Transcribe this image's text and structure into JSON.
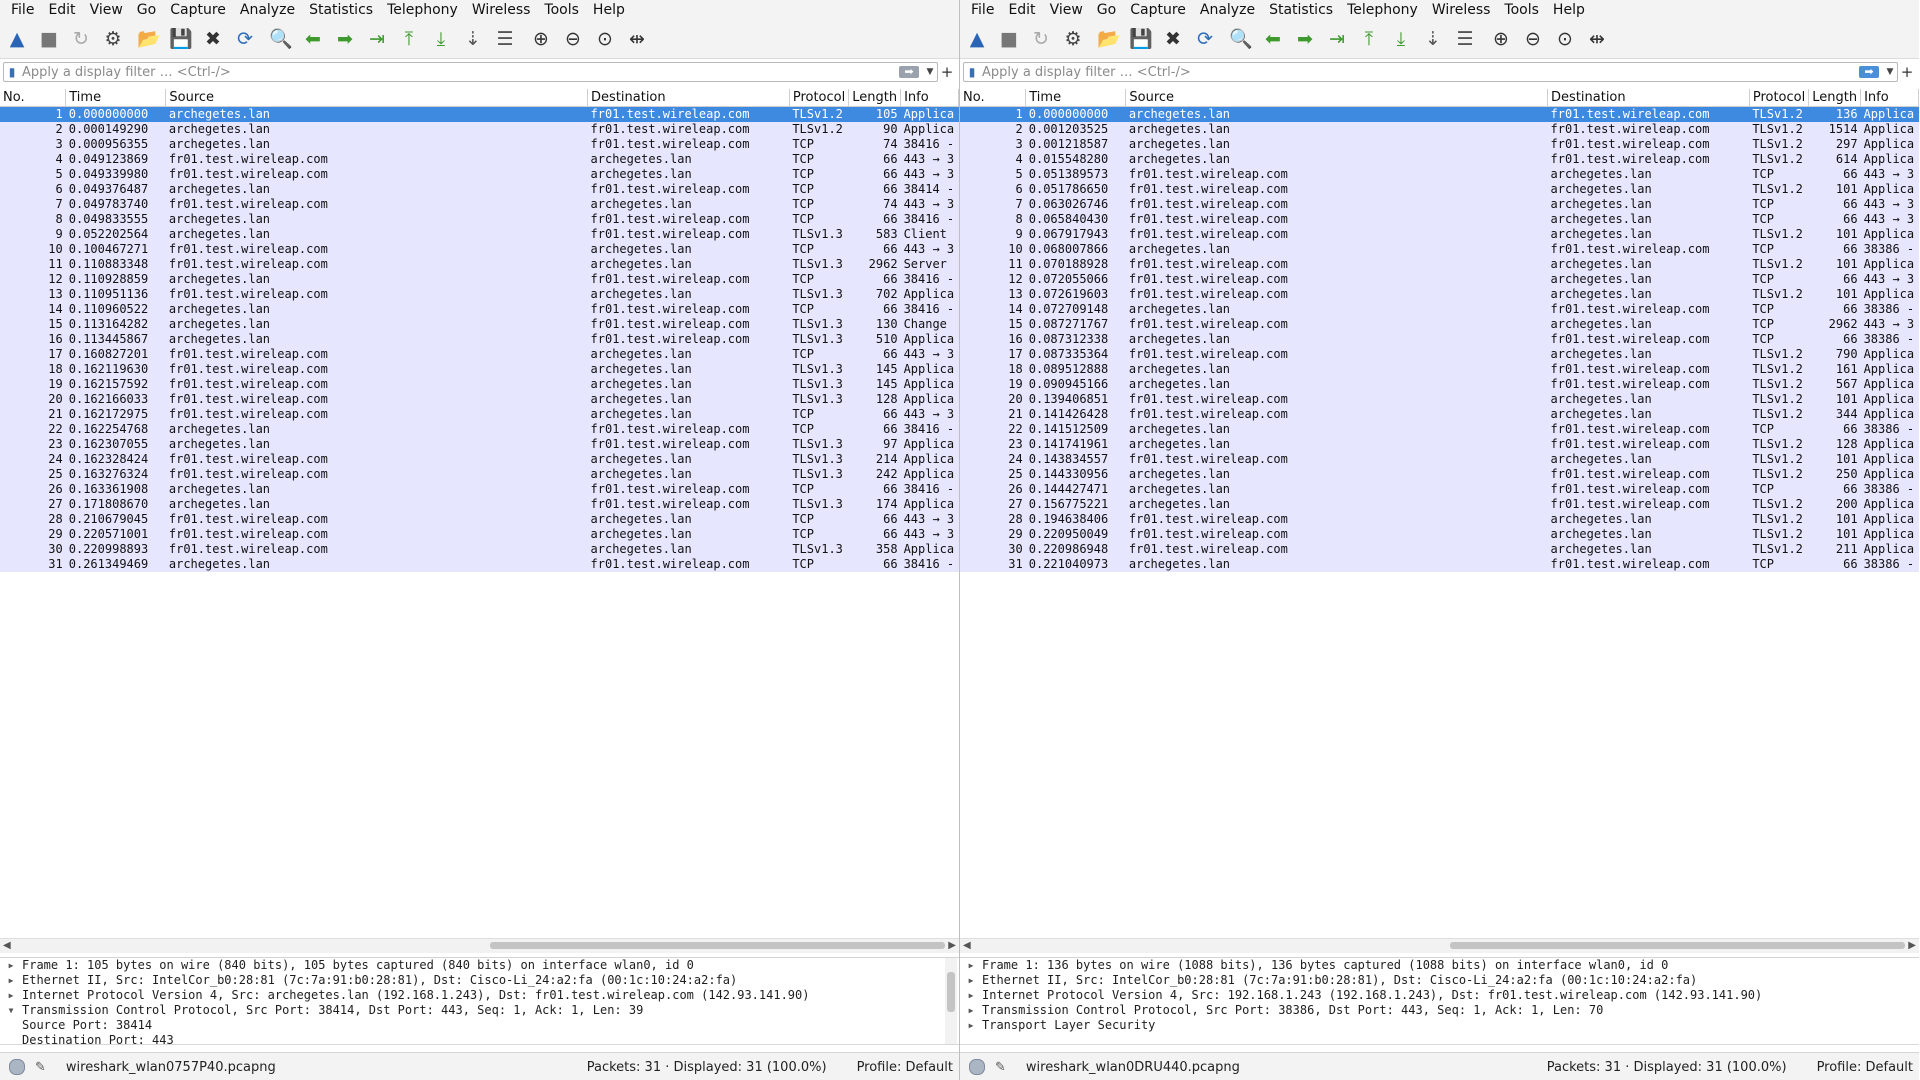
{
  "menu": [
    "File",
    "Edit",
    "View",
    "Go",
    "Capture",
    "Analyze",
    "Statistics",
    "Telephony",
    "Wireless",
    "Tools",
    "Help"
  ],
  "toolbar_icons": [
    "start-capture-icon",
    "stop-capture-icon",
    "restart-capture-icon",
    "capture-options-icon",
    "open-file-icon",
    "save-file-icon",
    "close-file-icon",
    "reload-file-icon",
    "find-packet-icon",
    "go-back-icon",
    "go-forward-icon",
    "go-to-packet-icon",
    "first-packet-icon",
    "last-packet-icon",
    "auto-scroll-icon",
    "colorize-icon",
    "zoom-in-icon",
    "zoom-out-icon",
    "normal-size-icon",
    "resize-columns-icon"
  ],
  "filter_placeholder": "Apply a display filter … <Ctrl-/>",
  "columns": [
    "No.",
    "Time",
    "Source",
    "Destination",
    "Protocol",
    "Length",
    "Info"
  ],
  "left": {
    "packets": [
      [
        "1",
        "0.000000000",
        "archegetes.lan",
        "fr01.test.wireleap.com",
        "TLSv1.2",
        "105",
        "Applica"
      ],
      [
        "2",
        "0.000149290",
        "archegetes.lan",
        "fr01.test.wireleap.com",
        "TLSv1.2",
        "90",
        "Applica"
      ],
      [
        "3",
        "0.000956355",
        "archegetes.lan",
        "fr01.test.wireleap.com",
        "TCP",
        "74",
        "38416 -"
      ],
      [
        "4",
        "0.049123869",
        "fr01.test.wireleap.com",
        "archegetes.lan",
        "TCP",
        "66",
        "443 → 3"
      ],
      [
        "5",
        "0.049339980",
        "fr01.test.wireleap.com",
        "archegetes.lan",
        "TCP",
        "66",
        "443 → 3"
      ],
      [
        "6",
        "0.049376487",
        "archegetes.lan",
        "fr01.test.wireleap.com",
        "TCP",
        "66",
        "38414 -"
      ],
      [
        "7",
        "0.049783740",
        "fr01.test.wireleap.com",
        "archegetes.lan",
        "TCP",
        "74",
        "443 → 3"
      ],
      [
        "8",
        "0.049833555",
        "archegetes.lan",
        "fr01.test.wireleap.com",
        "TCP",
        "66",
        "38416 -"
      ],
      [
        "9",
        "0.052202564",
        "archegetes.lan",
        "fr01.test.wireleap.com",
        "TLSv1.3",
        "583",
        "Client"
      ],
      [
        "10",
        "0.100467271",
        "fr01.test.wireleap.com",
        "archegetes.lan",
        "TCP",
        "66",
        "443 → 3"
      ],
      [
        "11",
        "0.110883348",
        "fr01.test.wireleap.com",
        "archegetes.lan",
        "TLSv1.3",
        "2962",
        "Server"
      ],
      [
        "12",
        "0.110928859",
        "archegetes.lan",
        "fr01.test.wireleap.com",
        "TCP",
        "66",
        "38416 -"
      ],
      [
        "13",
        "0.110951136",
        "fr01.test.wireleap.com",
        "archegetes.lan",
        "TLSv1.3",
        "702",
        "Applica"
      ],
      [
        "14",
        "0.110960522",
        "archegetes.lan",
        "fr01.test.wireleap.com",
        "TCP",
        "66",
        "38416 -"
      ],
      [
        "15",
        "0.113164282",
        "archegetes.lan",
        "fr01.test.wireleap.com",
        "TLSv1.3",
        "130",
        "Change"
      ],
      [
        "16",
        "0.113445867",
        "archegetes.lan",
        "fr01.test.wireleap.com",
        "TLSv1.3",
        "510",
        "Applica"
      ],
      [
        "17",
        "0.160827201",
        "fr01.test.wireleap.com",
        "archegetes.lan",
        "TCP",
        "66",
        "443 → 3"
      ],
      [
        "18",
        "0.162119630",
        "fr01.test.wireleap.com",
        "archegetes.lan",
        "TLSv1.3",
        "145",
        "Applica"
      ],
      [
        "19",
        "0.162157592",
        "fr01.test.wireleap.com",
        "archegetes.lan",
        "TLSv1.3",
        "145",
        "Applica"
      ],
      [
        "20",
        "0.162166033",
        "fr01.test.wireleap.com",
        "archegetes.lan",
        "TLSv1.3",
        "128",
        "Applica"
      ],
      [
        "21",
        "0.162172975",
        "fr01.test.wireleap.com",
        "archegetes.lan",
        "TCP",
        "66",
        "443 → 3"
      ],
      [
        "22",
        "0.162254768",
        "archegetes.lan",
        "fr01.test.wireleap.com",
        "TCP",
        "66",
        "38416 -"
      ],
      [
        "23",
        "0.162307055",
        "archegetes.lan",
        "fr01.test.wireleap.com",
        "TLSv1.3",
        "97",
        "Applica"
      ],
      [
        "24",
        "0.162328424",
        "fr01.test.wireleap.com",
        "archegetes.lan",
        "TLSv1.3",
        "214",
        "Applica"
      ],
      [
        "25",
        "0.163276324",
        "fr01.test.wireleap.com",
        "archegetes.lan",
        "TLSv1.3",
        "242",
        "Applica"
      ],
      [
        "26",
        "0.163361908",
        "archegetes.lan",
        "fr01.test.wireleap.com",
        "TCP",
        "66",
        "38416 -"
      ],
      [
        "27",
        "0.171808670",
        "archegetes.lan",
        "fr01.test.wireleap.com",
        "TLSv1.3",
        "174",
        "Applica"
      ],
      [
        "28",
        "0.210679045",
        "fr01.test.wireleap.com",
        "archegetes.lan",
        "TCP",
        "66",
        "443 → 3"
      ],
      [
        "29",
        "0.220571001",
        "fr01.test.wireleap.com",
        "archegetes.lan",
        "TCP",
        "66",
        "443 → 3"
      ],
      [
        "30",
        "0.220998893",
        "fr01.test.wireleap.com",
        "archegetes.lan",
        "TLSv1.3",
        "358",
        "Applica"
      ],
      [
        "31",
        "0.261349469",
        "archegetes.lan",
        "fr01.test.wireleap.com",
        "TCP",
        "66",
        "38416 -"
      ]
    ],
    "details": [
      {
        "toggle": "▶",
        "text": "Frame 1: 105 bytes on wire (840 bits), 105 bytes captured (840 bits) on interface wlan0, id 0"
      },
      {
        "toggle": "▶",
        "text": "Ethernet II, Src: IntelCor_b0:28:81 (7c:7a:91:b0:28:81), Dst: Cisco-Li_24:a2:fa (00:1c:10:24:a2:fa)"
      },
      {
        "toggle": "▶",
        "text": "Internet Protocol Version 4, Src: archegetes.lan (192.168.1.243), Dst: fr01.test.wireleap.com (142.93.141.90)"
      },
      {
        "toggle": "▼",
        "text": "Transmission Control Protocol, Src Port: 38414, Dst Port: 443, Seq: 1, Ack: 1, Len: 39"
      },
      {
        "toggle": "",
        "text": "  Source Port: 38414"
      },
      {
        "toggle": "",
        "text": "  Destination Port: 443"
      }
    ],
    "file": "wireshark_wlan0757P40.pcapng",
    "packets_status": "Packets: 31 · Displayed: 31 (100.0%)",
    "profile": "Profile: Default"
  },
  "right": {
    "packets": [
      [
        "1",
        "0.000000000",
        "archegetes.lan",
        "fr01.test.wireleap.com",
        "TLSv1.2",
        "136",
        "Applica"
      ],
      [
        "2",
        "0.001203525",
        "archegetes.lan",
        "fr01.test.wireleap.com",
        "TLSv1.2",
        "1514",
        "Applica"
      ],
      [
        "3",
        "0.001218587",
        "archegetes.lan",
        "fr01.test.wireleap.com",
        "TLSv1.2",
        "297",
        "Applica"
      ],
      [
        "4",
        "0.015548280",
        "archegetes.lan",
        "fr01.test.wireleap.com",
        "TLSv1.2",
        "614",
        "Applica"
      ],
      [
        "5",
        "0.051389573",
        "fr01.test.wireleap.com",
        "archegetes.lan",
        "TCP",
        "66",
        "443 → 3"
      ],
      [
        "6",
        "0.051786650",
        "fr01.test.wireleap.com",
        "archegetes.lan",
        "TLSv1.2",
        "101",
        "Applica"
      ],
      [
        "7",
        "0.063026746",
        "fr01.test.wireleap.com",
        "archegetes.lan",
        "TCP",
        "66",
        "443 → 3"
      ],
      [
        "8",
        "0.065840430",
        "fr01.test.wireleap.com",
        "archegetes.lan",
        "TCP",
        "66",
        "443 → 3"
      ],
      [
        "9",
        "0.067917943",
        "fr01.test.wireleap.com",
        "archegetes.lan",
        "TLSv1.2",
        "101",
        "Applica"
      ],
      [
        "10",
        "0.068007866",
        "archegetes.lan",
        "fr01.test.wireleap.com",
        "TCP",
        "66",
        "38386 -"
      ],
      [
        "11",
        "0.070188928",
        "fr01.test.wireleap.com",
        "archegetes.lan",
        "TLSv1.2",
        "101",
        "Applica"
      ],
      [
        "12",
        "0.072055066",
        "fr01.test.wireleap.com",
        "archegetes.lan",
        "TCP",
        "66",
        "443 → 3"
      ],
      [
        "13",
        "0.072619603",
        "fr01.test.wireleap.com",
        "archegetes.lan",
        "TLSv1.2",
        "101",
        "Applica"
      ],
      [
        "14",
        "0.072709148",
        "archegetes.lan",
        "fr01.test.wireleap.com",
        "TCP",
        "66",
        "38386 -"
      ],
      [
        "15",
        "0.087271767",
        "fr01.test.wireleap.com",
        "archegetes.lan",
        "TCP",
        "2962",
        "443 → 3"
      ],
      [
        "16",
        "0.087312338",
        "archegetes.lan",
        "fr01.test.wireleap.com",
        "TCP",
        "66",
        "38386 -"
      ],
      [
        "17",
        "0.087335364",
        "fr01.test.wireleap.com",
        "archegetes.lan",
        "TLSv1.2",
        "790",
        "Applica"
      ],
      [
        "18",
        "0.089512888",
        "archegetes.lan",
        "fr01.test.wireleap.com",
        "TLSv1.2",
        "161",
        "Applica"
      ],
      [
        "19",
        "0.090945166",
        "archegetes.lan",
        "fr01.test.wireleap.com",
        "TLSv1.2",
        "567",
        "Applica"
      ],
      [
        "20",
        "0.139406851",
        "fr01.test.wireleap.com",
        "archegetes.lan",
        "TLSv1.2",
        "101",
        "Applica"
      ],
      [
        "21",
        "0.141426428",
        "fr01.test.wireleap.com",
        "archegetes.lan",
        "TLSv1.2",
        "344",
        "Applica"
      ],
      [
        "22",
        "0.141512509",
        "archegetes.lan",
        "fr01.test.wireleap.com",
        "TCP",
        "66",
        "38386 -"
      ],
      [
        "23",
        "0.141741961",
        "archegetes.lan",
        "fr01.test.wireleap.com",
        "TLSv1.2",
        "128",
        "Applica"
      ],
      [
        "24",
        "0.143834557",
        "fr01.test.wireleap.com",
        "archegetes.lan",
        "TLSv1.2",
        "101",
        "Applica"
      ],
      [
        "25",
        "0.144330956",
        "archegetes.lan",
        "fr01.test.wireleap.com",
        "TLSv1.2",
        "250",
        "Applica"
      ],
      [
        "26",
        "0.144427471",
        "archegetes.lan",
        "fr01.test.wireleap.com",
        "TCP",
        "66",
        "38386 -"
      ],
      [
        "27",
        "0.156775221",
        "archegetes.lan",
        "fr01.test.wireleap.com",
        "TLSv1.2",
        "200",
        "Applica"
      ],
      [
        "28",
        "0.194638406",
        "fr01.test.wireleap.com",
        "archegetes.lan",
        "TLSv1.2",
        "101",
        "Applica"
      ],
      [
        "29",
        "0.220950049",
        "fr01.test.wireleap.com",
        "archegetes.lan",
        "TLSv1.2",
        "101",
        "Applica"
      ],
      [
        "30",
        "0.220986948",
        "fr01.test.wireleap.com",
        "archegetes.lan",
        "TLSv1.2",
        "211",
        "Applica"
      ],
      [
        "31",
        "0.221040973",
        "archegetes.lan",
        "fr01.test.wireleap.com",
        "TCP",
        "66",
        "38386 -"
      ]
    ],
    "details": [
      {
        "toggle": "▶",
        "text": "Frame 1: 136 bytes on wire (1088 bits), 136 bytes captured (1088 bits) on interface wlan0, id 0"
      },
      {
        "toggle": "▶",
        "text": "Ethernet II, Src: IntelCor_b0:28:81 (7c:7a:91:b0:28:81), Dst: Cisco-Li_24:a2:fa (00:1c:10:24:a2:fa)"
      },
      {
        "toggle": "▶",
        "text": "Internet Protocol Version 4, Src: 192.168.1.243 (192.168.1.243), Dst: fr01.test.wireleap.com (142.93.141.90)"
      },
      {
        "toggle": "▶",
        "text": "Transmission Control Protocol, Src Port: 38386, Dst Port: 443, Seq: 1, Ack: 1, Len: 70"
      },
      {
        "toggle": "▶",
        "text": "Transport Layer Security"
      }
    ],
    "file": "wireshark_wlan0DRU440.pcapng",
    "packets_status": "Packets: 31 · Displayed: 31 (100.0%)",
    "profile": "Profile: Default"
  },
  "colors": {
    "selected_row": "#3e8ae0",
    "row_bg": "#e7e6ff",
    "accent": "#4a90d9"
  }
}
